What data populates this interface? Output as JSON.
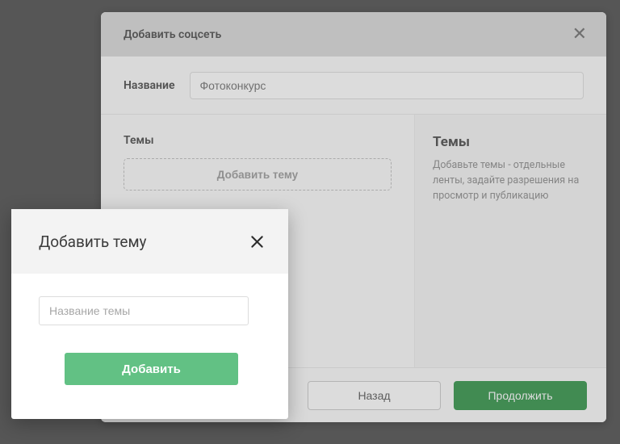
{
  "main_modal": {
    "title": "Добавить соцсеть",
    "name_label": "Название",
    "name_value": "Фотоконкурс",
    "left_title": "Темы",
    "add_topic_label": "Добавить тему",
    "right_title": "Темы",
    "right_text": "Добавьте темы - отдельные ленты, задайте разрешения на просмотр и публикацию",
    "back_label": "Назад",
    "continue_label": "Продолжить"
  },
  "popup": {
    "title": "Добавить тему",
    "input_placeholder": "Название темы",
    "add_label": "Добавить"
  }
}
